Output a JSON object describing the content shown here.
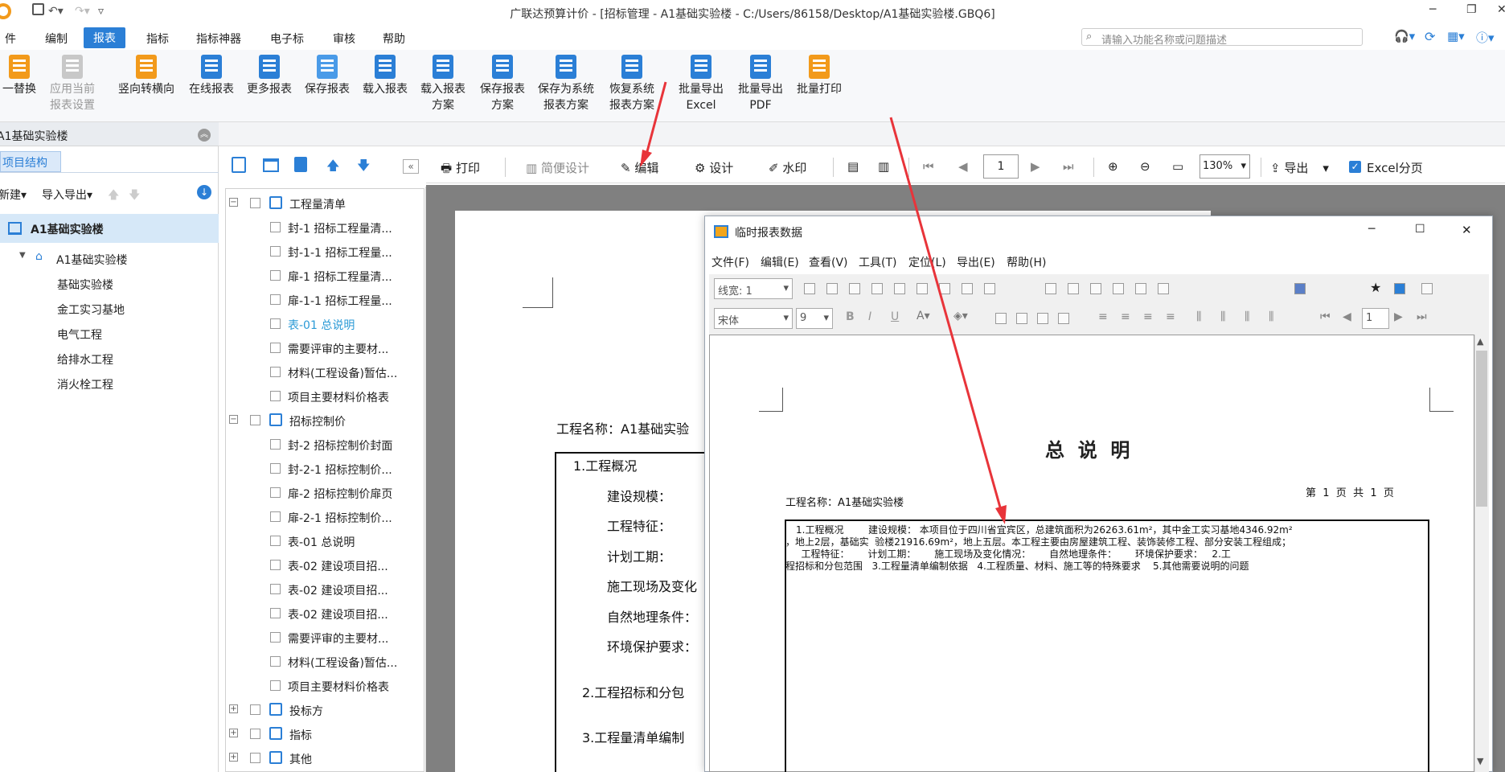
{
  "titlebar": {
    "title": "广联达预算计价 - [招标管理 - A1基础实验楼 - C:/Users/86158/Desktop/A1基础实验楼.GBQ6]"
  },
  "menus": [
    "件",
    "编制",
    "报表",
    "指标",
    "指标神器",
    "电子标",
    "审核",
    "帮助"
  ],
  "search": {
    "placeholder": "请输入功能名称或问题描述"
  },
  "ribbon": [
    {
      "l1": "一替换",
      "l2": ""
    },
    {
      "l1": "应用当前",
      "l2": "报表设置"
    },
    {
      "l1": "竖向转横向",
      "l2": ""
    },
    {
      "l1": "在线报表",
      "l2": ""
    },
    {
      "l1": "更多报表",
      "l2": ""
    },
    {
      "l1": "保存报表",
      "l2": ""
    },
    {
      "l1": "载入报表",
      "l2": ""
    },
    {
      "l1": "载入报表",
      "l2": "方案"
    },
    {
      "l1": "保存报表",
      "l2": "方案"
    },
    {
      "l1": "保存为系统",
      "l2": "报表方案"
    },
    {
      "l1": "恢复系统",
      "l2": "报表方案"
    },
    {
      "l1": "批量导出",
      "l2": "Excel"
    },
    {
      "l1": "批量导出",
      "l2": "PDF"
    },
    {
      "l1": "批量打印",
      "l2": ""
    }
  ],
  "left": {
    "project": "A1基础实验楼",
    "tab": "项目结构",
    "new": "新建",
    "io": "导入导出",
    "root": "A1基础实验楼",
    "sub": "A1基础实验楼",
    "children": [
      "基础实验楼",
      "金工实习基地",
      "电气工程",
      "给排水工程",
      "消火栓工程"
    ]
  },
  "tree": {
    "g1": "工程量清单",
    "g1items": [
      "封-1 招标工程量清...",
      "封-1-1 招标工程量...",
      "扉-1 招标工程量清...",
      "扉-1-1 招标工程量...",
      "表-01 总说明",
      "需要评审的主要材...",
      "材料(工程设备)暂估...",
      "项目主要材料价格表"
    ],
    "g2": "招标控制价",
    "g2items": [
      "封-2 招标控制价封面",
      "封-2-1 招标控制价...",
      "扉-2 招标控制价扉页",
      "扉-2-1 招标控制价...",
      "表-01 总说明",
      "表-02 建设项目招...",
      "表-02 建设项目招...",
      "表-02 建设项目招...",
      "需要评审的主要材...",
      "材料(工程设备)暂估...",
      "项目主要材料价格表"
    ],
    "g3": "投标方",
    "g4": "指标",
    "g5": "其他"
  },
  "reporttool": {
    "print": "打印",
    "simple": "简便设计",
    "edit": "编辑",
    "design": "设计",
    "watermark": "水印",
    "page": "1",
    "zoom": "130%",
    "export": "导出",
    "excel": "Excel分页"
  },
  "paper": {
    "proj": "工程名称：A1基础实验",
    "lines": [
      "1.工程概况",
      "建设规模：",
      "工程特征：",
      "计划工期：",
      "施工现场及变化",
      "自然地理条件：",
      "环境保护要求：",
      "2.工程招标和分包",
      "3.工程量清单编制"
    ]
  },
  "dialog": {
    "title": "临时报表数据",
    "menus": [
      "文件(F)",
      "编辑(E)",
      "查看(V)",
      "工具(T)",
      "定位(L)",
      "导出(E)",
      "帮助(H)"
    ],
    "linewidth": "线宽: 1",
    "font": "宋体",
    "size": "9",
    "page": "1",
    "heading": "总  说  明",
    "proj": "工程名称：A1基础实验楼",
    "pageinfo": "第  1  页  共  1  页",
    "body1": "1.工程概况        建设规模： 本项目位于四川省宜宾区，总建筑面积为26263.61m²，其中金工实习基地4346.92m²",
    "body2": "，地上2层，基础实  验楼21916.69m²，地上五层。本工程主要由房屋建筑工程、装饰装修工程、部分安装工程组成；",
    "body3": "   工程特征：      计划工期：      施工现场及变化情况：      自然地理条件：      环境保护要求：   2.工",
    "body4": "程招标和分包范围   3.工程量清单编制依据   4.工程质量、材料、施工等的特殊要求    5.其他需要说明的问题"
  },
  "colors": {
    "accent": "#2b7fd6",
    "arrow": "#e8343a"
  }
}
